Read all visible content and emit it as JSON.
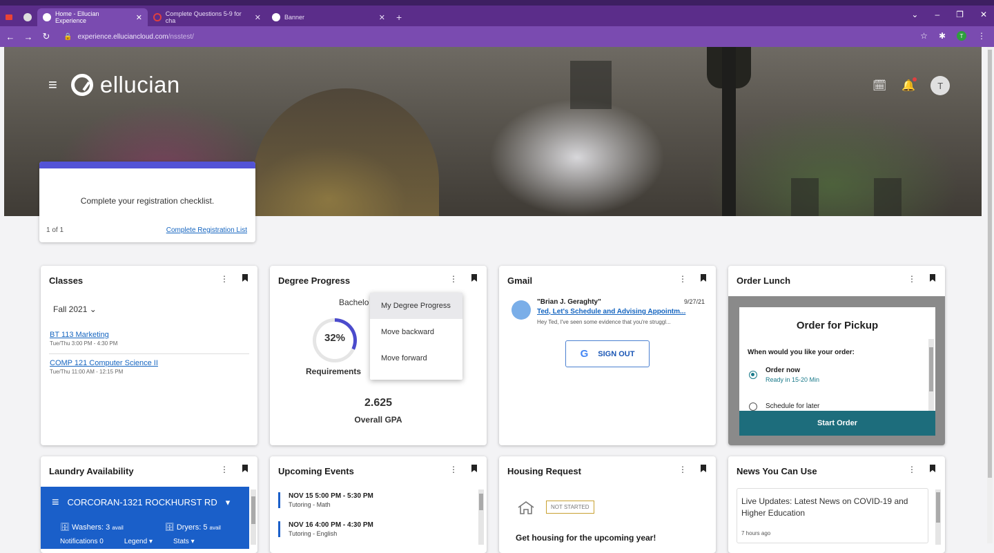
{
  "browser": {
    "tabs": [
      {
        "label": "Home - Ellucian Experience",
        "active": true
      },
      {
        "label": "Complete Questions 5-9 for cha",
        "active": false
      },
      {
        "label": "Banner",
        "active": false
      }
    ],
    "url_host": "experience.elluciancloud.com",
    "url_path": "/nsstest/",
    "new_tab": "+",
    "close": "✕",
    "ext_avatar": "T"
  },
  "header": {
    "brand": "ellucian",
    "user_initial": "T"
  },
  "checklist": {
    "message": "Complete your registration checklist.",
    "pager": "1 of 1",
    "link": "Complete Registration List"
  },
  "classes": {
    "title": "Classes",
    "term": "Fall 2021",
    "items": [
      {
        "name": "BT 113 Marketing",
        "schedule": "Tue/Thu 3:00 PM - 4:30 PM"
      },
      {
        "name": "COMP 121 Computer Science II",
        "schedule": "Tue/Thu 11:00 AM - 12:15 PM"
      }
    ]
  },
  "degree": {
    "title": "Degree Progress",
    "program": "Bachelo",
    "percent": "32%",
    "percent_value": 32,
    "req_label": "Requirements",
    "gpa": "2.625",
    "gpa_label": "Overall GPA",
    "menu": [
      "My Degree Progress",
      "Move backward",
      "Move forward"
    ]
  },
  "gmail": {
    "title": "Gmail",
    "from": "\"Brian J. Geraghty\"",
    "date": "9/27/21",
    "subject": "Ted, Let's Schedule and Advising Appointm...",
    "preview": "Hey Ted, I've seen some evidence that you're struggl...",
    "signout": "SIGN OUT"
  },
  "lunch": {
    "title": "Order Lunch",
    "modal_title": "Order for Pickup",
    "question": "When would you like your order:",
    "opt1": "Order now",
    "opt1_sub": "Ready in 15-20 Min",
    "opt2": "Schedule for later",
    "start": "Start Order"
  },
  "laundry": {
    "title": "Laundry Availability",
    "location": "CORCORAN-1321 ROCKHURST RD",
    "washers": "Washers: 3",
    "washers_suffix": "avail",
    "dryers": "Dryers: 5",
    "dryers_suffix": "avail",
    "notifications": "Notifications 0",
    "legend": "Legend",
    "stats": "Stats"
  },
  "events": {
    "title": "Upcoming Events",
    "items": [
      {
        "date": "NOV 15 5:00 PM - 5:30 PM",
        "name": "Tutoring - Math"
      },
      {
        "date": "NOV 16 4:00 PM - 4:30 PM",
        "name": "Tutoring - English"
      }
    ]
  },
  "housing": {
    "title": "Housing Request",
    "status": "NOT STARTED",
    "text": "Get housing for the upcoming year!"
  },
  "news": {
    "title": "News You Can Use",
    "headline": "Live Updates: Latest News on COVID-19 and Higher Education",
    "age": "7 hours ago"
  },
  "colors": {
    "browser_purple": "#5b2d8a",
    "accent_blue": "#1565c0",
    "checklist_bar": "#5353d6",
    "teal": "#1d6d7c"
  }
}
